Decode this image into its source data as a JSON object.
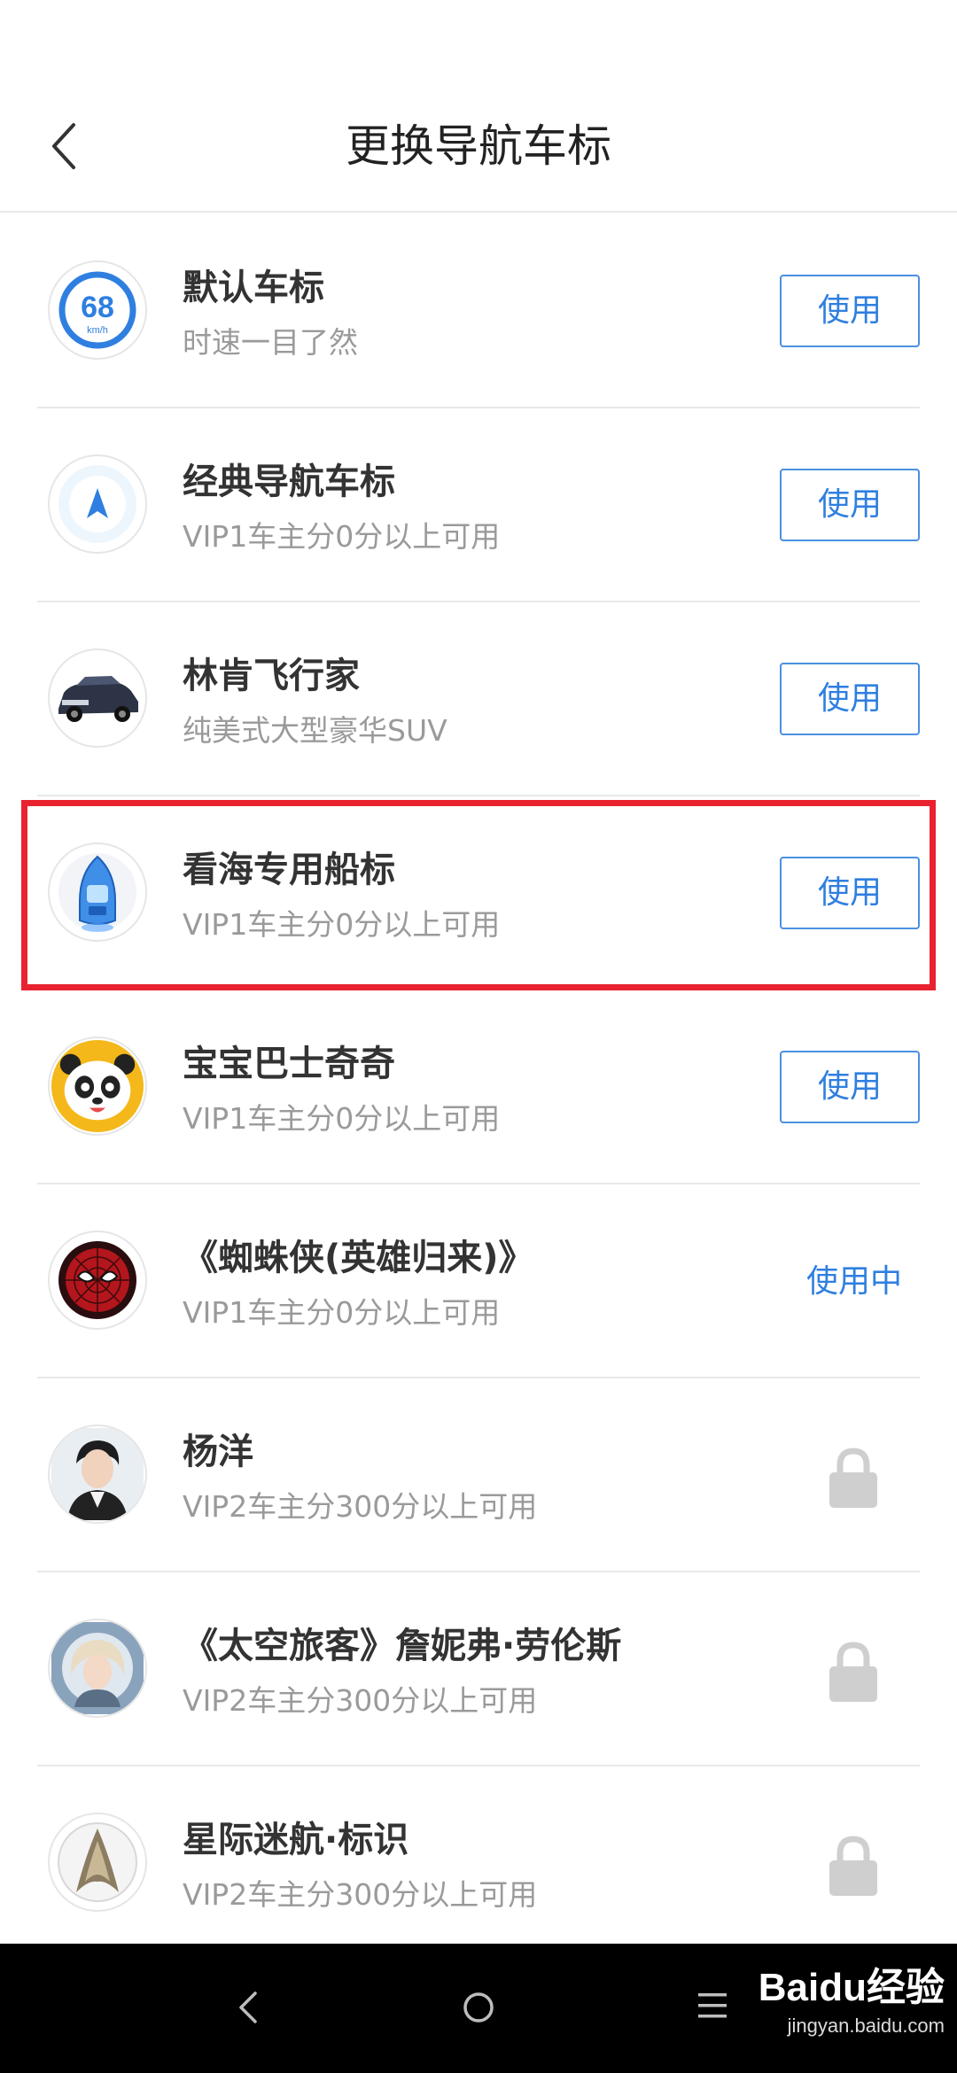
{
  "header": {
    "title": "更换导航车标"
  },
  "items": [
    {
      "title": "默认车标",
      "subtitle": "时速一目了然",
      "state": "use",
      "action_label": "使用",
      "icon": "speed-68-icon",
      "speed": "68",
      "speed_unit": "km/h"
    },
    {
      "title": "经典导航车标",
      "subtitle": "VIP1车主分0分以上可用",
      "state": "use",
      "action_label": "使用",
      "icon": "navigation-arrow-icon"
    },
    {
      "title": "林肯飞行家",
      "subtitle": "纯美式大型豪华SUV",
      "state": "use",
      "action_label": "使用",
      "icon": "suv-car-icon"
    },
    {
      "title": "看海专用船标",
      "subtitle": "VIP1车主分0分以上可用",
      "state": "use",
      "action_label": "使用",
      "icon": "boat-icon"
    },
    {
      "title": "宝宝巴士奇奇",
      "subtitle": "VIP1车主分0分以上可用",
      "state": "use",
      "action_label": "使用",
      "icon": "panda-icon"
    },
    {
      "title": "《蜘蛛侠(英雄归来)》",
      "subtitle": "VIP1车主分0分以上可用",
      "state": "in_use",
      "action_label": "使用中",
      "icon": "spiderman-icon"
    },
    {
      "title": "杨洋",
      "subtitle": "VIP2车主分300分以上可用",
      "state": "locked",
      "icon": "person-portrait-icon"
    },
    {
      "title": "《太空旅客》詹妮弗·劳伦斯",
      "subtitle": "VIP2车主分300分以上可用",
      "state": "locked",
      "icon": "person-portrait-icon"
    },
    {
      "title": "星际迷航·标识",
      "subtitle": "VIP2车主分300分以上可用",
      "state": "locked",
      "icon": "starfleet-badge-icon"
    }
  ],
  "watermark": {
    "brand": "Baidu经验",
    "url": "jingyan.baidu.com"
  },
  "colors": {
    "accent": "#2f7fe0",
    "highlight": "#e8232f",
    "lock": "#cfcfcf"
  }
}
